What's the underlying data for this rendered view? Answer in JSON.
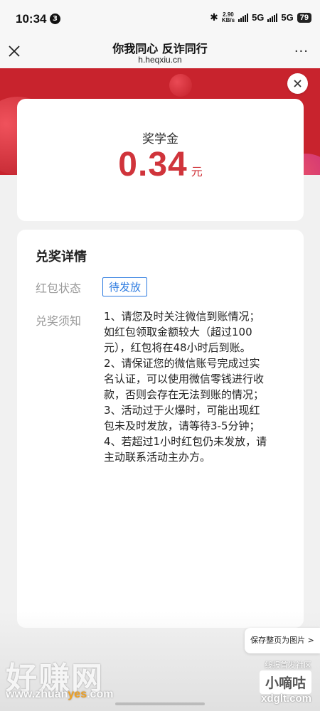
{
  "status_bar": {
    "time": "10:34",
    "notification_count": "3",
    "net_speed_value": "2.90",
    "net_speed_unit": "KB/s",
    "signal1_label": "5G",
    "signal2_label": "5G",
    "battery": "79"
  },
  "title_bar": {
    "title": "你我同心 反诈同行",
    "url": "h.heqxiu.cn",
    "more": "···"
  },
  "amount_card": {
    "label": "奖学金",
    "value": "0.34",
    "unit": "元"
  },
  "details": {
    "title": "兑奖详情",
    "status_label": "红包状态",
    "status_value": "待发放",
    "notice_label": "兑奖须知",
    "notice_lines": [
      "1、请您及时关注微信到账情况；",
      "如红包领取金额较大（超过100",
      "元），红包将在48小时后到账。",
      "2、请保证您的微信账号完成过实",
      "名认证，可以使用微信零钱进行收",
      "款，否则会存在无法到账的情况；",
      "3、活动过于火爆时，可能出现红",
      "包未及时发放，请等待3-5分钟；",
      "4、若超过1小时红包仍未发放，请",
      "主动联系活动主办方。"
    ]
  },
  "save_button": "保存整页为图片 >",
  "watermark": {
    "logo": "好赚网",
    "site_pre": "www.zhuan",
    "site_hl": "yes",
    "site_post": ".com",
    "tag": "线报首发社区",
    "badge": "小嘀咕",
    "domain": "xdglt.com"
  },
  "colors": {
    "header_red": "#c8232d",
    "amount_red": "#d0343b",
    "tag_blue": "#2d7be0"
  }
}
